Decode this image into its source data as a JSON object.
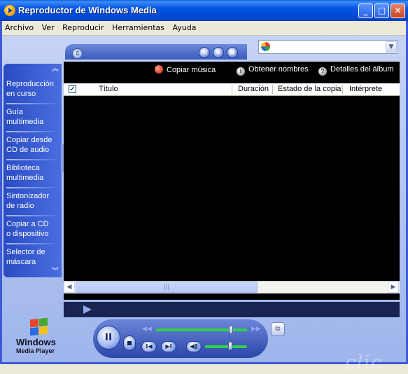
{
  "window": {
    "title": "Reproductor de Windows Media",
    "minimize": "_",
    "maximize": "□",
    "close": "✕"
  },
  "menu": {
    "items": [
      "Archivo",
      "Ver",
      "Reproducir",
      "Herramientas",
      "Ayuda"
    ]
  },
  "sidebar": {
    "items": [
      {
        "line1": "Reproducción",
        "line2": "en curso"
      },
      {
        "line1": "Guía",
        "line2": "multimedia"
      },
      {
        "line1": "Copiar desde",
        "line2": "CD de audio"
      },
      {
        "line1": "Biblioteca",
        "line2": "multimedia"
      },
      {
        "line1": "Sintonizador",
        "line2": "de radio"
      },
      {
        "line1": "Copiar a CD",
        "line2": "o dispositivo"
      },
      {
        "line1": "Selector de",
        "line2": "máscara"
      }
    ],
    "active_index": 2
  },
  "actions": {
    "copy_music": "Copiar música",
    "get_names": "Obtener nombres",
    "album_details": "Detalles del álbum"
  },
  "columns": [
    "Título",
    "Duración",
    "Estado de la copia",
    "Intérprete"
  ],
  "header_checkbox": "✓",
  "transport": {
    "play_pause": "II",
    "seek_level": 0.82,
    "volume_level": 0.6
  },
  "logo": {
    "word": "Windows",
    "sub": "Media Player"
  },
  "watermark": "clic"
}
